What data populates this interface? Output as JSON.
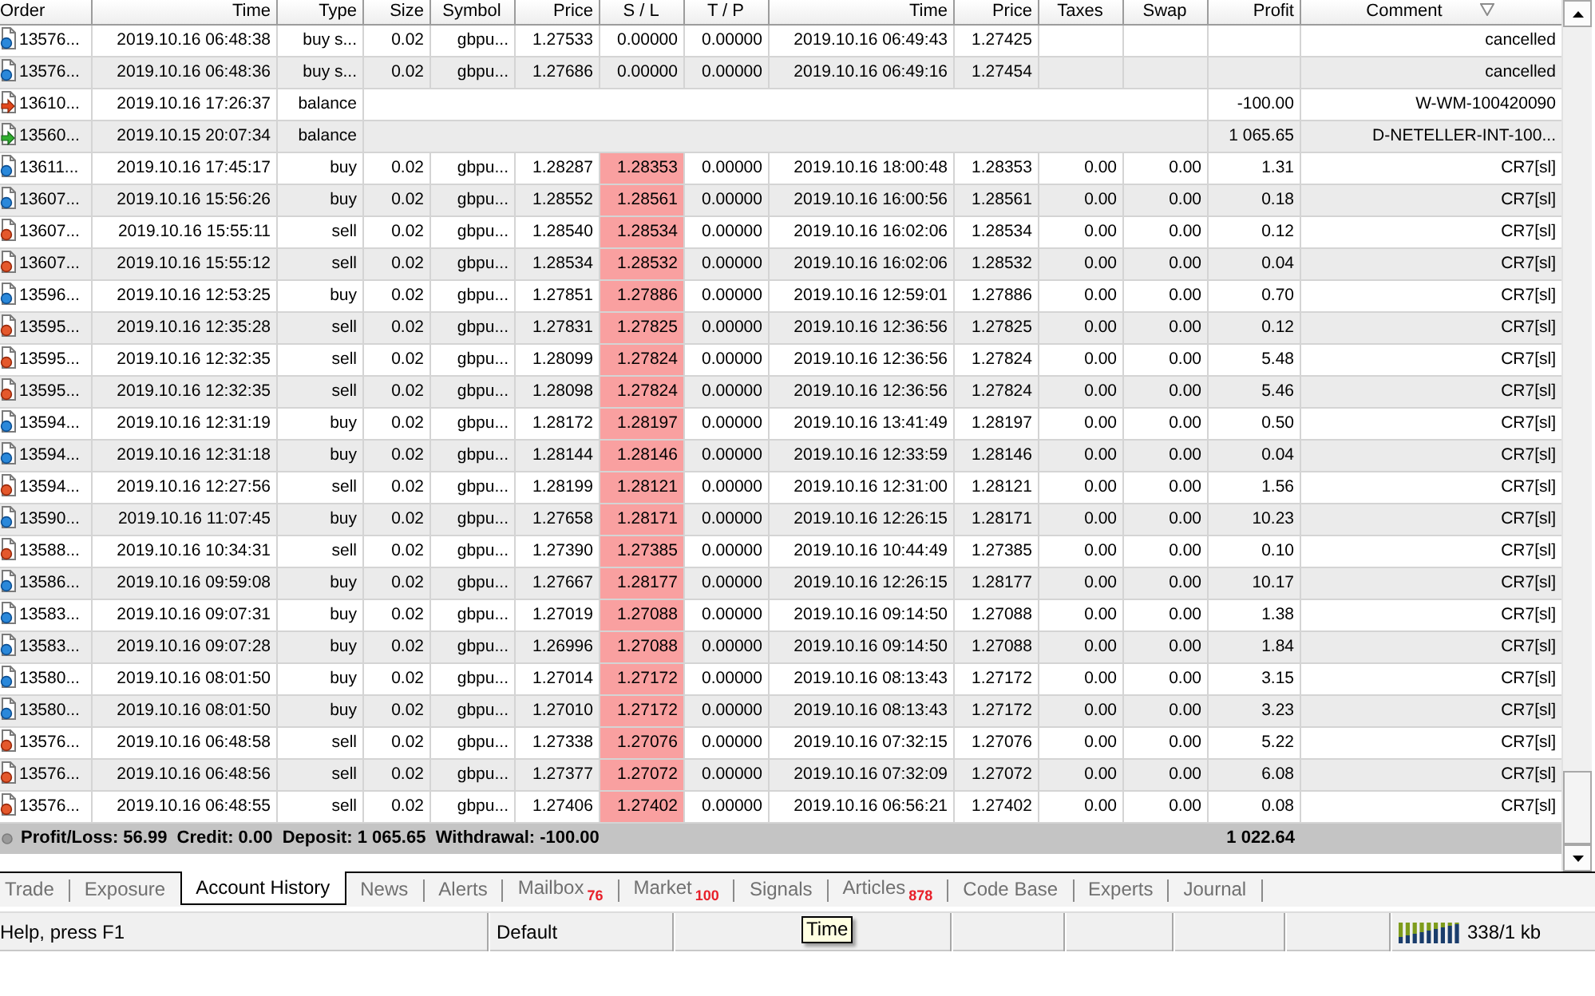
{
  "table": {
    "columns": [
      {
        "label": "Order",
        "sorted": false
      },
      {
        "label": "Time",
        "sorted": false
      },
      {
        "label": "Type",
        "sorted": false
      },
      {
        "label": "Size",
        "sorted": false
      },
      {
        "label": "Symbol",
        "sorted": false
      },
      {
        "label": "Price",
        "sorted": false
      },
      {
        "label": "S / L",
        "sorted": false
      },
      {
        "label": "T / P",
        "sorted": false
      },
      {
        "label": "Time",
        "sorted": false
      },
      {
        "label": "Price",
        "sorted": false
      },
      {
        "label": "Taxes",
        "sorted": false
      },
      {
        "label": "Swap",
        "sorted": false
      },
      {
        "label": "Profit",
        "sorted": false
      },
      {
        "label": "Comment",
        "sorted": true
      }
    ],
    "rows": [
      {
        "kind": "buy",
        "order": "13576...",
        "time": "2019.10.16 06:48:38",
        "type": "buy s...",
        "size": "0.02",
        "symbol": "gbpu...",
        "price": "1.27533",
        "sl": "0.00000",
        "sl_hit": false,
        "tp": "0.00000",
        "close_time": "2019.10.16 06:49:43",
        "close_price": "1.27425",
        "comment": "cancelled"
      },
      {
        "kind": "buy",
        "order": "13576...",
        "time": "2019.10.16 06:48:36",
        "type": "buy s...",
        "size": "0.02",
        "symbol": "gbpu...",
        "price": "1.27686",
        "sl": "0.00000",
        "sl_hit": false,
        "tp": "0.00000",
        "close_time": "2019.10.16 06:49:16",
        "close_price": "1.27454",
        "comment": "cancelled"
      },
      {
        "kind": "withdrawal",
        "order": "13610...",
        "time": "2019.10.16 17:26:37",
        "type": "balance",
        "profit": "-100.00",
        "comment": "W-WM-100420090"
      },
      {
        "kind": "deposit",
        "order": "13560...",
        "time": "2019.10.15 20:07:34",
        "type": "balance",
        "profit": "1 065.65",
        "comment": "D-NETELLER-INT-100..."
      },
      {
        "kind": "buy",
        "order": "13611...",
        "time": "2019.10.16 17:45:17",
        "type": "buy",
        "size": "0.02",
        "symbol": "gbpu...",
        "price": "1.28287",
        "sl": "1.28353",
        "sl_hit": true,
        "tp": "0.00000",
        "close_time": "2019.10.16 18:00:48",
        "close_price": "1.28353",
        "taxes": "0.00",
        "swap": "0.00",
        "profit": "1.31",
        "comment": "CR7[sl]"
      },
      {
        "kind": "buy",
        "order": "13607...",
        "time": "2019.10.16 15:56:26",
        "type": "buy",
        "size": "0.02",
        "symbol": "gbpu...",
        "price": "1.28552",
        "sl": "1.28561",
        "sl_hit": true,
        "tp": "0.00000",
        "close_time": "2019.10.16 16:00:56",
        "close_price": "1.28561",
        "taxes": "0.00",
        "swap": "0.00",
        "profit": "0.18",
        "comment": "CR7[sl]"
      },
      {
        "kind": "sell",
        "order": "13607...",
        "time": "2019.10.16 15:55:11",
        "type": "sell",
        "size": "0.02",
        "symbol": "gbpu...",
        "price": "1.28540",
        "sl": "1.28534",
        "sl_hit": true,
        "tp": "0.00000",
        "close_time": "2019.10.16 16:02:06",
        "close_price": "1.28534",
        "taxes": "0.00",
        "swap": "0.00",
        "profit": "0.12",
        "comment": "CR7[sl]"
      },
      {
        "kind": "sell",
        "order": "13607...",
        "time": "2019.10.16 15:55:12",
        "type": "sell",
        "size": "0.02",
        "symbol": "gbpu...",
        "price": "1.28534",
        "sl": "1.28532",
        "sl_hit": true,
        "tp": "0.00000",
        "close_time": "2019.10.16 16:02:06",
        "close_price": "1.28532",
        "taxes": "0.00",
        "swap": "0.00",
        "profit": "0.04",
        "comment": "CR7[sl]"
      },
      {
        "kind": "buy",
        "order": "13596...",
        "time": "2019.10.16 12:53:25",
        "type": "buy",
        "size": "0.02",
        "symbol": "gbpu...",
        "price": "1.27851",
        "sl": "1.27886",
        "sl_hit": true,
        "tp": "0.00000",
        "close_time": "2019.10.16 12:59:01",
        "close_price": "1.27886",
        "taxes": "0.00",
        "swap": "0.00",
        "profit": "0.70",
        "comment": "CR7[sl]"
      },
      {
        "kind": "sell",
        "order": "13595...",
        "time": "2019.10.16 12:35:28",
        "type": "sell",
        "size": "0.02",
        "symbol": "gbpu...",
        "price": "1.27831",
        "sl": "1.27825",
        "sl_hit": true,
        "tp": "0.00000",
        "close_time": "2019.10.16 12:36:56",
        "close_price": "1.27825",
        "taxes": "0.00",
        "swap": "0.00",
        "profit": "0.12",
        "comment": "CR7[sl]"
      },
      {
        "kind": "sell",
        "order": "13595...",
        "time": "2019.10.16 12:32:35",
        "type": "sell",
        "size": "0.02",
        "symbol": "gbpu...",
        "price": "1.28099",
        "sl": "1.27824",
        "sl_hit": true,
        "tp": "0.00000",
        "close_time": "2019.10.16 12:36:56",
        "close_price": "1.27824",
        "taxes": "0.00",
        "swap": "0.00",
        "profit": "5.48",
        "comment": "CR7[sl]"
      },
      {
        "kind": "sell",
        "order": "13595...",
        "time": "2019.10.16 12:32:35",
        "type": "sell",
        "size": "0.02",
        "symbol": "gbpu...",
        "price": "1.28098",
        "sl": "1.27824",
        "sl_hit": true,
        "tp": "0.00000",
        "close_time": "2019.10.16 12:36:56",
        "close_price": "1.27824",
        "taxes": "0.00",
        "swap": "0.00",
        "profit": "5.46",
        "comment": "CR7[sl]"
      },
      {
        "kind": "buy",
        "order": "13594...",
        "time": "2019.10.16 12:31:19",
        "type": "buy",
        "size": "0.02",
        "symbol": "gbpu...",
        "price": "1.28172",
        "sl": "1.28197",
        "sl_hit": true,
        "tp": "0.00000",
        "close_time": "2019.10.16 13:41:49",
        "close_price": "1.28197",
        "taxes": "0.00",
        "swap": "0.00",
        "profit": "0.50",
        "comment": "CR7[sl]"
      },
      {
        "kind": "buy",
        "order": "13594...",
        "time": "2019.10.16 12:31:18",
        "type": "buy",
        "size": "0.02",
        "symbol": "gbpu...",
        "price": "1.28144",
        "sl": "1.28146",
        "sl_hit": true,
        "tp": "0.00000",
        "close_time": "2019.10.16 12:33:59",
        "close_price": "1.28146",
        "taxes": "0.00",
        "swap": "0.00",
        "profit": "0.04",
        "comment": "CR7[sl]"
      },
      {
        "kind": "sell",
        "order": "13594...",
        "time": "2019.10.16 12:27:56",
        "type": "sell",
        "size": "0.02",
        "symbol": "gbpu...",
        "price": "1.28199",
        "sl": "1.28121",
        "sl_hit": true,
        "tp": "0.00000",
        "close_time": "2019.10.16 12:31:00",
        "close_price": "1.28121",
        "taxes": "0.00",
        "swap": "0.00",
        "profit": "1.56",
        "comment": "CR7[sl]"
      },
      {
        "kind": "buy",
        "order": "13590...",
        "time": "2019.10.16 11:07:45",
        "type": "buy",
        "size": "0.02",
        "symbol": "gbpu...",
        "price": "1.27658",
        "sl": "1.28171",
        "sl_hit": true,
        "tp": "0.00000",
        "close_time": "2019.10.16 12:26:15",
        "close_price": "1.28171",
        "taxes": "0.00",
        "swap": "0.00",
        "profit": "10.23",
        "comment": "CR7[sl]"
      },
      {
        "kind": "sell",
        "order": "13588...",
        "time": "2019.10.16 10:34:31",
        "type": "sell",
        "size": "0.02",
        "symbol": "gbpu...",
        "price": "1.27390",
        "sl": "1.27385",
        "sl_hit": true,
        "tp": "0.00000",
        "close_time": "2019.10.16 10:44:49",
        "close_price": "1.27385",
        "taxes": "0.00",
        "swap": "0.00",
        "profit": "0.10",
        "comment": "CR7[sl]"
      },
      {
        "kind": "buy",
        "order": "13586...",
        "time": "2019.10.16 09:59:08",
        "type": "buy",
        "size": "0.02",
        "symbol": "gbpu...",
        "price": "1.27667",
        "sl": "1.28177",
        "sl_hit": true,
        "tp": "0.00000",
        "close_time": "2019.10.16 12:26:15",
        "close_price": "1.28177",
        "taxes": "0.00",
        "swap": "0.00",
        "profit": "10.17",
        "comment": "CR7[sl]"
      },
      {
        "kind": "buy",
        "order": "13583...",
        "time": "2019.10.16 09:07:31",
        "type": "buy",
        "size": "0.02",
        "symbol": "gbpu...",
        "price": "1.27019",
        "sl": "1.27088",
        "sl_hit": true,
        "tp": "0.00000",
        "close_time": "2019.10.16 09:14:50",
        "close_price": "1.27088",
        "taxes": "0.00",
        "swap": "0.00",
        "profit": "1.38",
        "comment": "CR7[sl]"
      },
      {
        "kind": "buy",
        "order": "13583...",
        "time": "2019.10.16 09:07:28",
        "type": "buy",
        "size": "0.02",
        "symbol": "gbpu...",
        "price": "1.26996",
        "sl": "1.27088",
        "sl_hit": true,
        "tp": "0.00000",
        "close_time": "2019.10.16 09:14:50",
        "close_price": "1.27088",
        "taxes": "0.00",
        "swap": "0.00",
        "profit": "1.84",
        "comment": "CR7[sl]"
      },
      {
        "kind": "buy",
        "order": "13580...",
        "time": "2019.10.16 08:01:50",
        "type": "buy",
        "size": "0.02",
        "symbol": "gbpu...",
        "price": "1.27014",
        "sl": "1.27172",
        "sl_hit": true,
        "tp": "0.00000",
        "close_time": "2019.10.16 08:13:43",
        "close_price": "1.27172",
        "taxes": "0.00",
        "swap": "0.00",
        "profit": "3.15",
        "comment": "CR7[sl]"
      },
      {
        "kind": "buy",
        "order": "13580...",
        "time": "2019.10.16 08:01:50",
        "type": "buy",
        "size": "0.02",
        "symbol": "gbpu...",
        "price": "1.27010",
        "sl": "1.27172",
        "sl_hit": true,
        "tp": "0.00000",
        "close_time": "2019.10.16 08:13:43",
        "close_price": "1.27172",
        "taxes": "0.00",
        "swap": "0.00",
        "profit": "3.23",
        "comment": "CR7[sl]"
      },
      {
        "kind": "sell",
        "order": "13576...",
        "time": "2019.10.16 06:48:58",
        "type": "sell",
        "size": "0.02",
        "symbol": "gbpu...",
        "price": "1.27338",
        "sl": "1.27076",
        "sl_hit": true,
        "tp": "0.00000",
        "close_time": "2019.10.16 07:32:15",
        "close_price": "1.27076",
        "taxes": "0.00",
        "swap": "0.00",
        "profit": "5.22",
        "comment": "CR7[sl]"
      },
      {
        "kind": "sell",
        "order": "13576...",
        "time": "2019.10.16 06:48:56",
        "type": "sell",
        "size": "0.02",
        "symbol": "gbpu...",
        "price": "1.27377",
        "sl": "1.27072",
        "sl_hit": true,
        "tp": "0.00000",
        "close_time": "2019.10.16 07:32:09",
        "close_price": "1.27072",
        "taxes": "0.00",
        "swap": "0.00",
        "profit": "6.08",
        "comment": "CR7[sl]"
      },
      {
        "kind": "sell",
        "order": "13576...",
        "time": "2019.10.16 06:48:55",
        "type": "sell",
        "size": "0.02",
        "symbol": "gbpu...",
        "price": "1.27406",
        "sl": "1.27402",
        "sl_hit": true,
        "tp": "0.00000",
        "close_time": "2019.10.16 06:56:21",
        "close_price": "1.27402",
        "taxes": "0.00",
        "swap": "0.00",
        "profit": "0.08",
        "comment": "CR7[sl]"
      }
    ],
    "summary": {
      "text": "Profit/Loss: 56.99  Credit: 0.00  Deposit: 1 065.65  Withdrawal: -100.00",
      "total": "1 022.64"
    }
  },
  "tabs": [
    {
      "label": "Trade",
      "selected": false
    },
    {
      "label": "Exposure",
      "selected": false
    },
    {
      "label": "Account History",
      "selected": true
    },
    {
      "label": "News",
      "selected": false
    },
    {
      "label": "Alerts",
      "selected": false
    },
    {
      "label": "Mailbox",
      "badge": "76",
      "selected": false
    },
    {
      "label": "Market",
      "badge": "100",
      "selected": false
    },
    {
      "label": "Signals",
      "selected": false
    },
    {
      "label": "Articles",
      "badge": "878",
      "selected": false
    },
    {
      "label": "Code Base",
      "selected": false
    },
    {
      "label": "Experts",
      "selected": false
    },
    {
      "label": "Journal",
      "selected": false
    }
  ],
  "status_bar": {
    "help": "Help, press F1",
    "profile": "Default",
    "tooltip": "Time",
    "traffic": "338/1 kb"
  }
}
